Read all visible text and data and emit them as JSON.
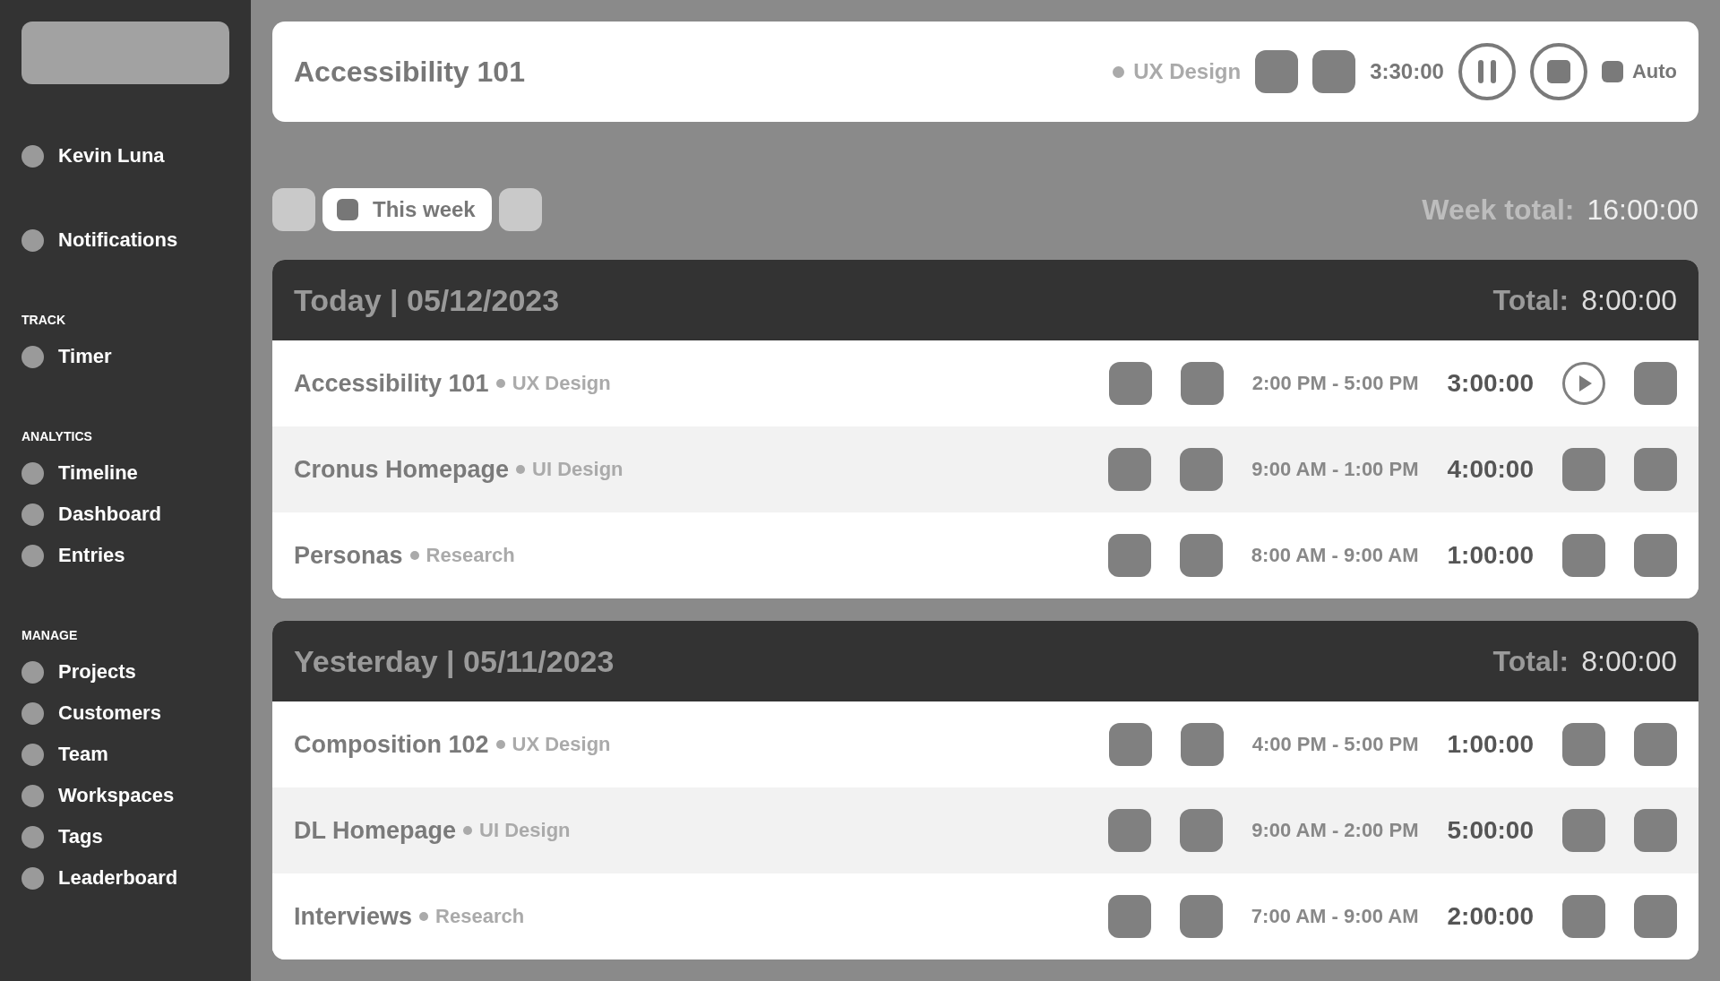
{
  "sidebar": {
    "user": {
      "name": "Kevin Luna"
    },
    "notifications": {
      "label": "Notifications"
    },
    "sections": [
      {
        "title": "TRACK",
        "items": [
          {
            "label": "Timer"
          }
        ]
      },
      {
        "title": "ANALYTICS",
        "items": [
          {
            "label": "Timeline"
          },
          {
            "label": "Dashboard"
          },
          {
            "label": "Entries"
          }
        ]
      },
      {
        "title": "MANAGE",
        "items": [
          {
            "label": "Projects"
          },
          {
            "label": "Customers"
          },
          {
            "label": "Team"
          },
          {
            "label": "Workspaces"
          },
          {
            "label": "Tags"
          },
          {
            "label": "Leaderboard"
          }
        ]
      }
    ]
  },
  "timer": {
    "title": "Accessibility 101",
    "category": "UX Design",
    "duration": "3:30:00",
    "running": true,
    "auto_label": "Auto"
  },
  "filter": {
    "range_label": "This week"
  },
  "week_total": {
    "label": "Week total:",
    "value": "16:00:00"
  },
  "days": [
    {
      "title": "Today | 05/12/2023",
      "total_label": "Total:",
      "total": "8:00:00",
      "entries": [
        {
          "project": "Accessibility 101",
          "category": "UX Design",
          "time_range": "2:00 PM - 5:00 PM",
          "duration": "3:00:00",
          "playable": true
        },
        {
          "project": "Cronus Homepage",
          "category": "UI Design",
          "time_range": "9:00 AM - 1:00 PM",
          "duration": "4:00:00",
          "playable": false
        },
        {
          "project": "Personas",
          "category": "Research",
          "time_range": "8:00 AM - 9:00 AM",
          "duration": "1:00:00",
          "playable": false
        }
      ]
    },
    {
      "title": "Yesterday | 05/11/2023",
      "total_label": "Total:",
      "total": "8:00:00",
      "entries": [
        {
          "project": "Composition 102",
          "category": "UX Design",
          "time_range": "4:00 PM - 5:00 PM",
          "duration": "1:00:00",
          "playable": false
        },
        {
          "project": "DL Homepage",
          "category": "UI Design",
          "time_range": "9:00 AM - 2:00 PM",
          "duration": "5:00:00",
          "playable": false
        },
        {
          "project": "Interviews",
          "category": "Research",
          "time_range": "7:00 AM - 9:00 AM",
          "duration": "2:00:00",
          "playable": false
        }
      ]
    }
  ]
}
